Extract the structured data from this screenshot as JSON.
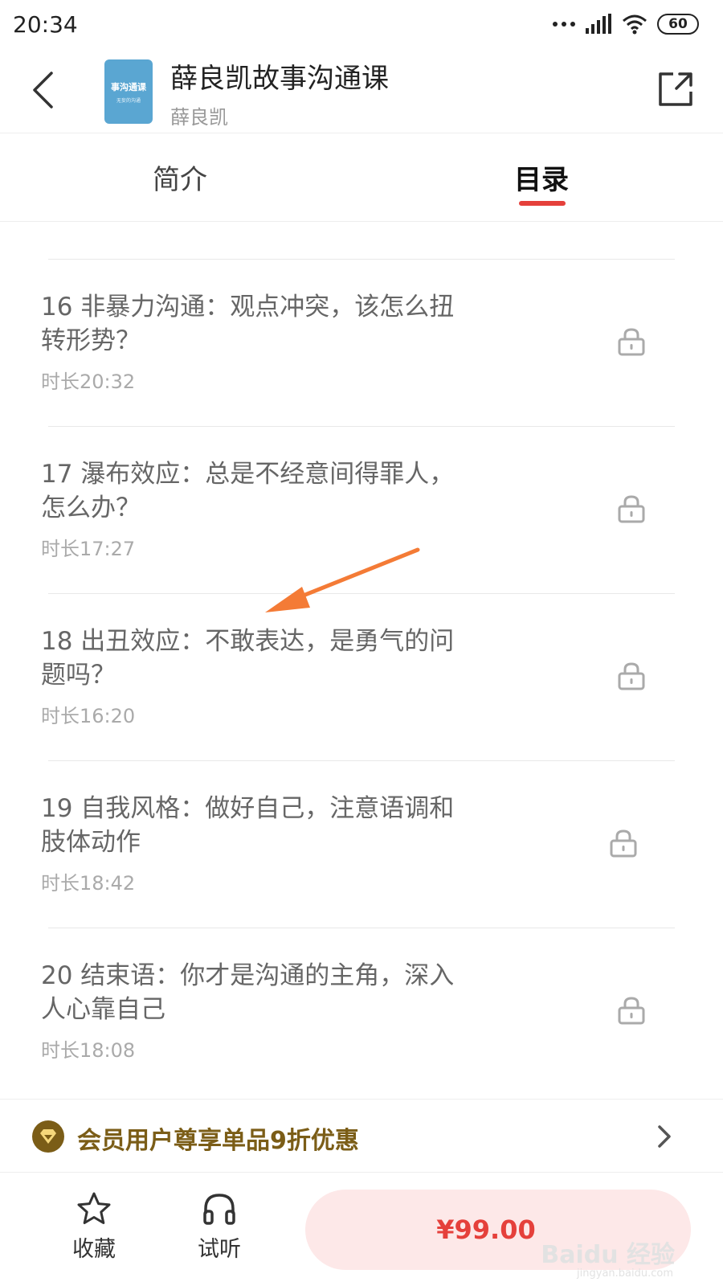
{
  "status_bar": {
    "time": "20:34",
    "battery": "60"
  },
  "header": {
    "title": "薛良凯故事沟通课",
    "author": "薛良凯",
    "cover_text": "事沟通课",
    "cover_subtext": "无妄的沟通"
  },
  "tabs": [
    {
      "label": "简介",
      "active": false
    },
    {
      "label": "目录",
      "active": true
    }
  ],
  "episodes": [
    {
      "title": "16 非暴力沟通：观点冲突，该怎么扭转形势？",
      "duration": "时长20:32",
      "locked": true
    },
    {
      "title": "17 瀑布效应：总是不经意间得罪人，怎么办？",
      "duration": "时长17:27",
      "locked": true
    },
    {
      "title": "18 出丑效应：不敢表达，是勇气的问题吗？",
      "duration": "时长16:20",
      "locked": true
    },
    {
      "title": "19 自我风格：做好自己，注意语调和肢体动作",
      "duration": "时长18:42",
      "locked": true
    },
    {
      "title": "20 结束语：你才是沟通的主角，深入人心靠自己",
      "duration": "时长18:08",
      "locked": true
    }
  ],
  "member_bar": {
    "text": "会员用户尊享单品9折优惠"
  },
  "bottom_bar": {
    "favorite_label": "收藏",
    "listen_label": "试听",
    "price": "¥99.00"
  },
  "watermark": {
    "text": "Baidu 经验",
    "sub": "jingyan.baidu.com"
  },
  "colors": {
    "accent": "#e5403b",
    "member_gold": "#7b5d17",
    "arrow": "#f47b36",
    "buy_bg": "#fde8e8"
  },
  "icons": [
    "back-chevron-icon",
    "share-icon",
    "lock-icon",
    "member-diamond-icon",
    "chevron-right-icon",
    "star-icon",
    "headphones-icon"
  ]
}
